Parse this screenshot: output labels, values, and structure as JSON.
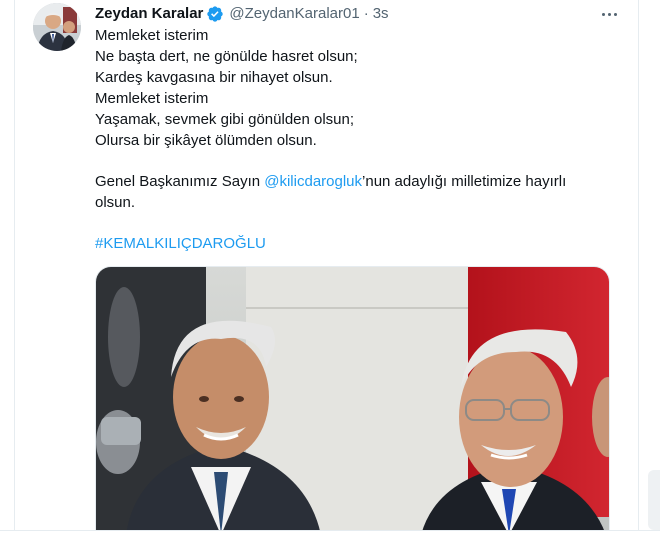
{
  "author": {
    "name": "Zeydan Karalar",
    "handle": "@ZeydanKaralar01",
    "separator": "·",
    "time": "3s",
    "verified_color": "#1d9bf0"
  },
  "tweet": {
    "lines": [
      "Memleket isterim",
      "Ne başta dert, ne gönülde hasret olsun;",
      "Kardeş kavgasına bir nihayet olsun.",
      "Memleket isterim",
      "Yaşamak, sevmek gibi gönülden olsun;",
      "Olursa bir şikâyet ölümden olsun."
    ],
    "closing_prefix": "Genel Başkanımız Sayın ",
    "mention": "@kilicdarogluk",
    "closing_suffix": "’nun adaylığı milletimize hayırlı",
    "closing_line2": "olsun.",
    "hashtag": "#KEMALKILIÇDAROĞLU"
  },
  "colors": {
    "link": "#1d9bf0",
    "text": "#0f1419",
    "muted": "#536471"
  },
  "icons": {
    "verified": "verified-badge-icon",
    "more": "more-options-icon"
  }
}
